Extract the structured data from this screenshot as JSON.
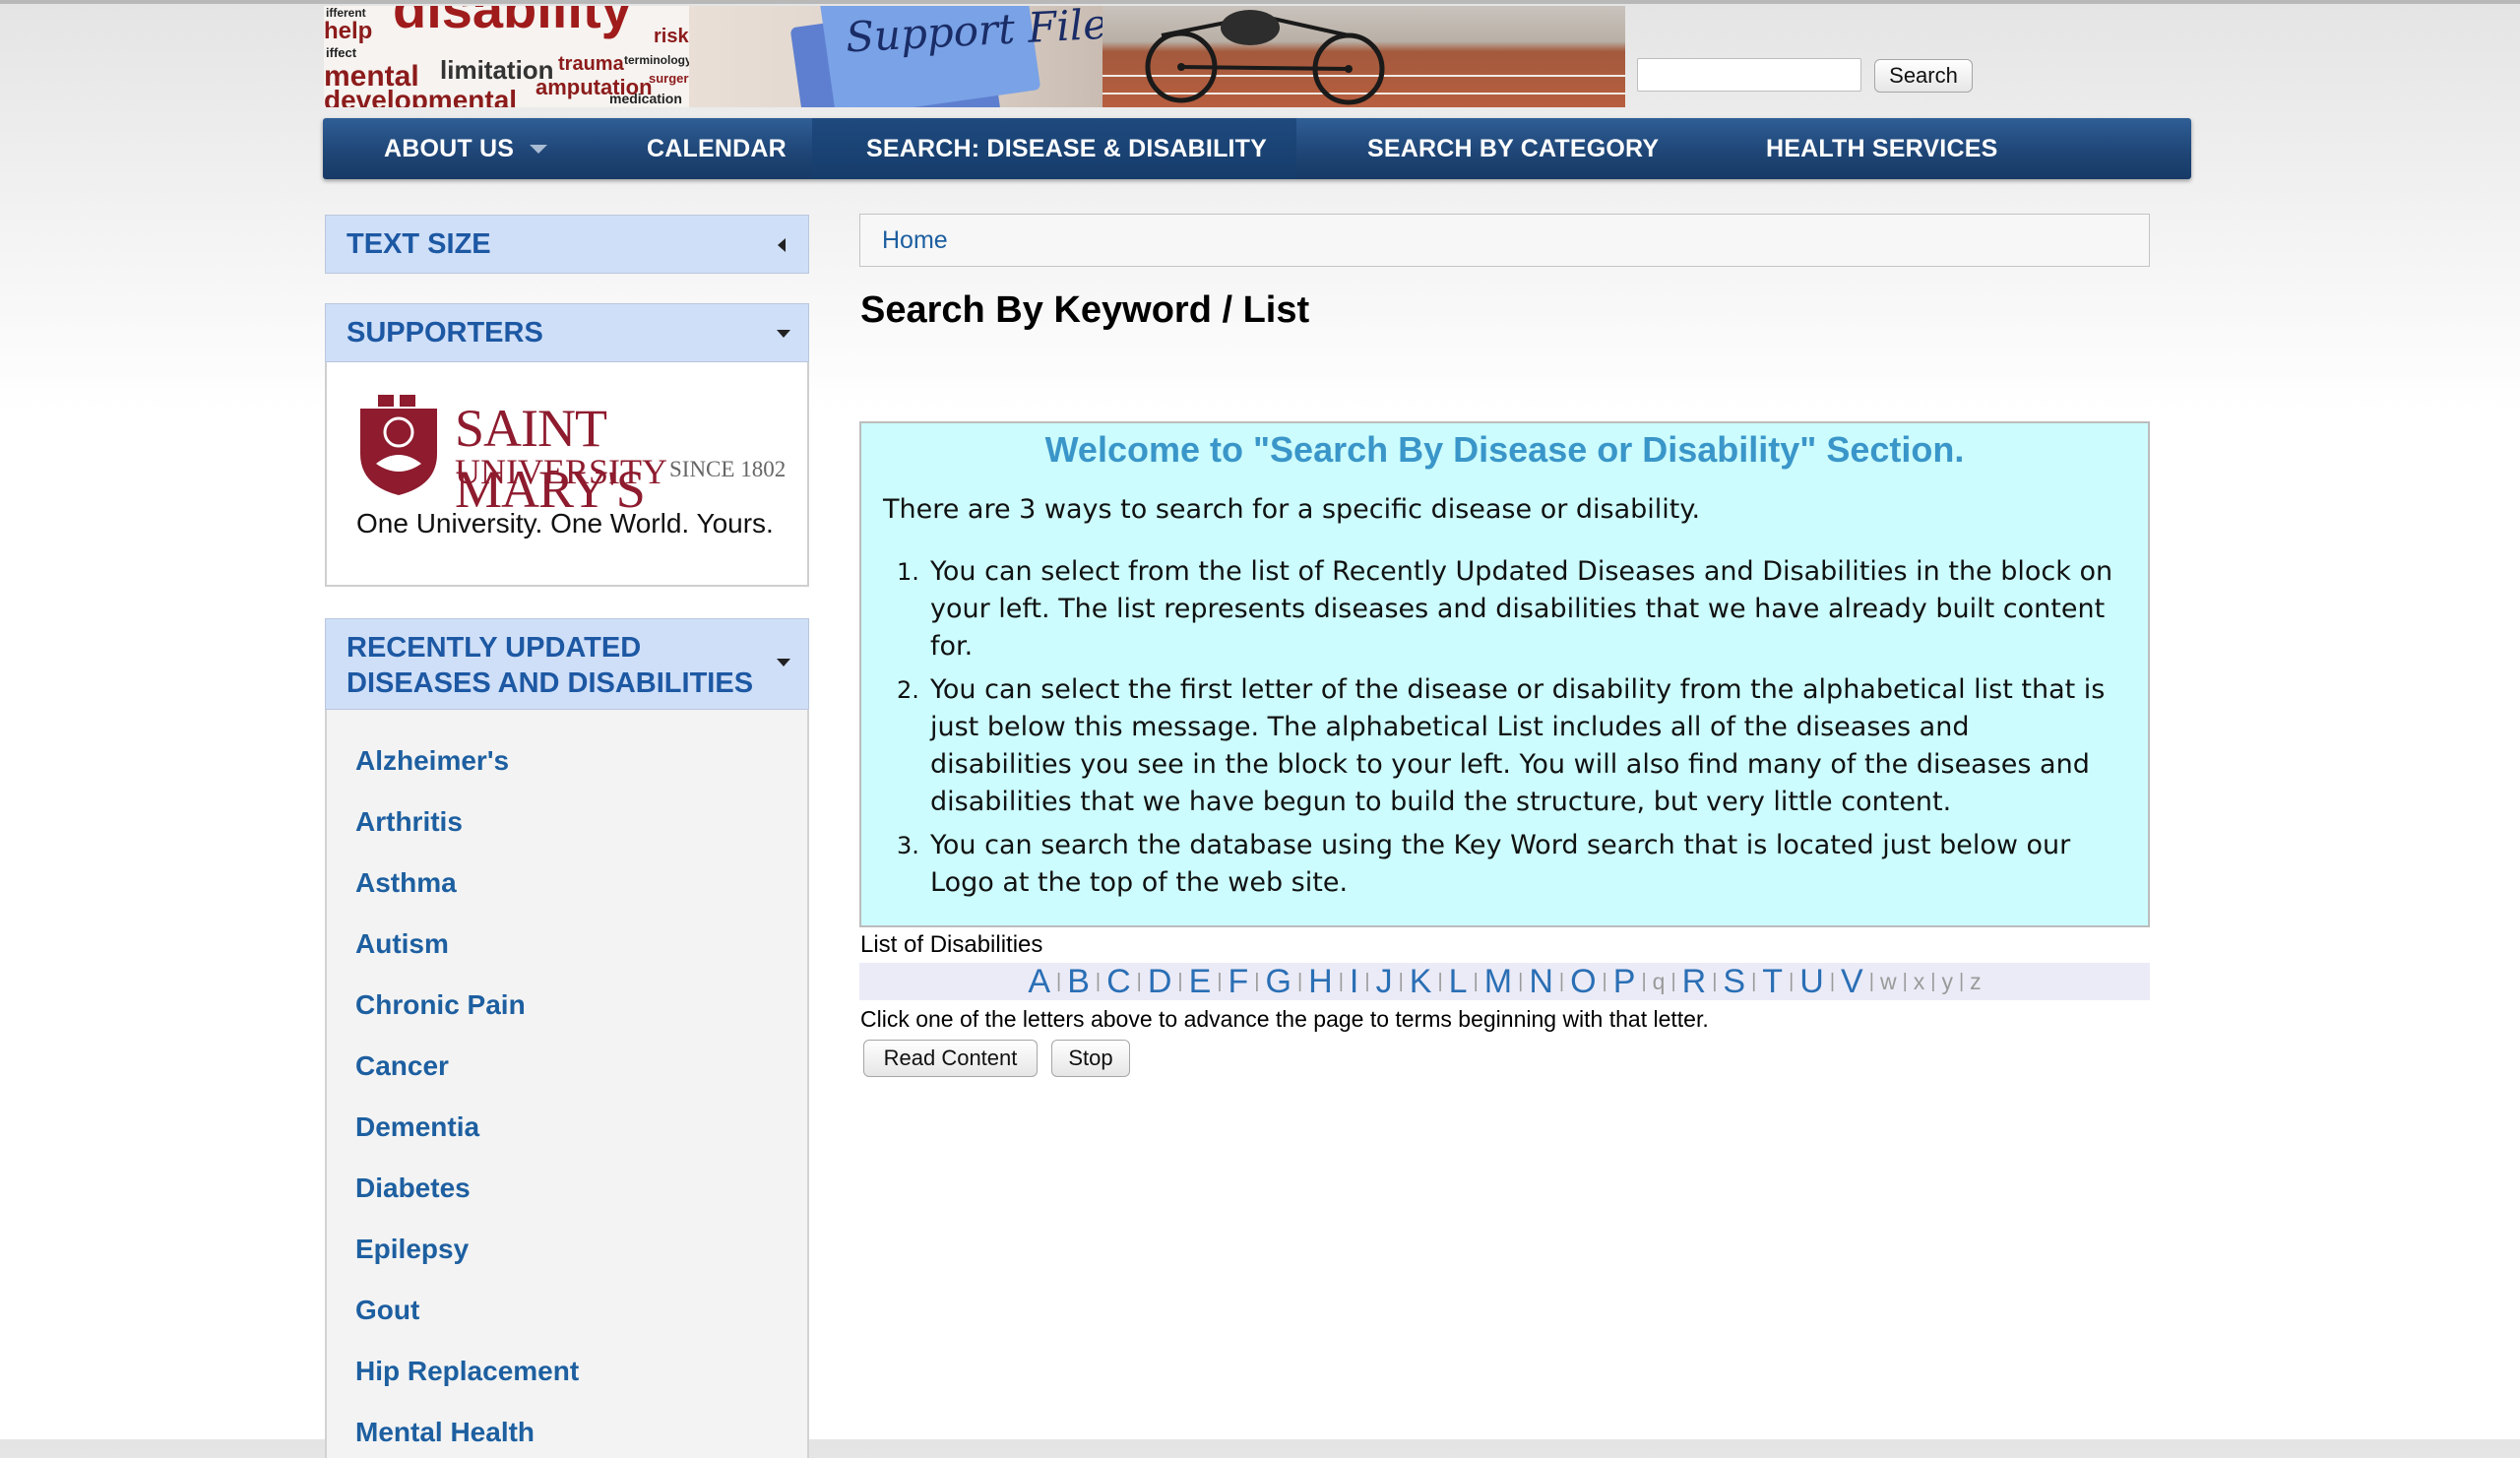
{
  "header": {
    "banner_words": [
      "ifferent",
      "help",
      "iffect",
      "disability",
      "risk",
      "mental",
      "limitation",
      "trauma",
      "terminology",
      "surgery",
      "developmental",
      "amputation",
      "medication"
    ],
    "banner_folder_text": "Support Files",
    "search": {
      "placeholder": "",
      "value": "",
      "button_label": "Search"
    }
  },
  "nav": {
    "items": [
      {
        "label": "ABOUT US",
        "has_dropdown": true
      },
      {
        "label": "CALENDAR"
      },
      {
        "label": "SEARCH: DISEASE & DISABILITY",
        "active": true
      },
      {
        "label": "SEARCH BY CATEGORY"
      },
      {
        "label": "HEALTH SERVICES"
      }
    ]
  },
  "sidebar": {
    "text_size": {
      "title": "TEXT SIZE"
    },
    "supporters": {
      "title": "SUPPORTERS",
      "logo": {
        "line1": "SAINT MARY'S",
        "line2": "UNIVERSITY",
        "since": "SINCE 1802",
        "tagline": "One University. One World. Yours."
      }
    },
    "recent": {
      "title_line1": "RECENTLY UPDATED",
      "title_line2": "DISEASES AND DISABILITIES",
      "items": [
        "Alzheimer's",
        "Arthritis",
        "Asthma",
        "Autism",
        "Chronic Pain",
        "Cancer",
        "Dementia",
        "Diabetes",
        "Epilepsy",
        "Gout",
        "Hip Replacement",
        "Mental Health"
      ]
    }
  },
  "main": {
    "breadcrumb": "Home",
    "title": "Search By Keyword / List",
    "welcome": {
      "heading": "Welcome to \"Search By Disease or Disability\" Section.",
      "intro": "There are 3 ways to search for a specific disease or disability.",
      "items": [
        {
          "num": "1.",
          "lines": [
            "You can select from the list of Recently Updated Diseases and Disabilities in the block on",
            "your left.  The list represents diseases and disabilities that we have already built content",
            "for."
          ]
        },
        {
          "num": "2.",
          "lines": [
            "You can select the first letter of the disease or disability from the alphabetical list that is",
            "just below this message.  The alphabetical List includes all of the diseases and",
            "disabilities you see in the block to your left.  You will also find many of the diseases and",
            "disabilities that we have begun to build the structure, but very little content."
          ]
        },
        {
          "num": "3.",
          "lines": [
            "You can search the database using the Key Word search that is located just below our",
            "Logo at the top of the web site."
          ]
        }
      ]
    },
    "list_label": "List of Disabilities",
    "alphabet": {
      "active": [
        "A",
        "B",
        "C",
        "D",
        "E",
        "F",
        "G",
        "H",
        "I",
        "J",
        "K",
        "L",
        "M",
        "N",
        "O",
        "P"
      ],
      "inactive_mid": [
        "q"
      ],
      "active2": [
        "R",
        "S",
        "T",
        "U",
        "V"
      ],
      "inactive_end": [
        "w",
        "x",
        "y",
        "z"
      ],
      "separator": "|"
    },
    "hint": "Click one of the letters above to advance the page to terms beginning with that letter.",
    "buttons": {
      "read": "Read Content",
      "stop": "Stop"
    }
  }
}
